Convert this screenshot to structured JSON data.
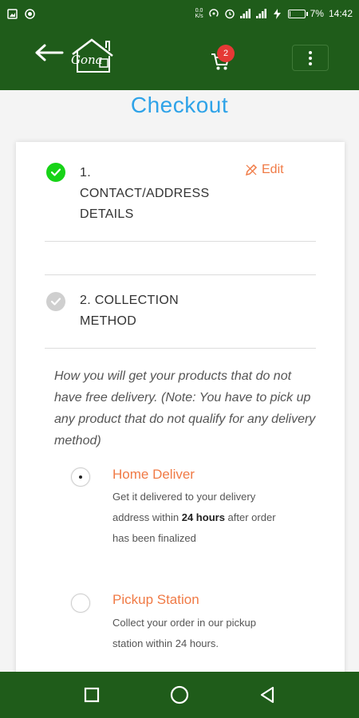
{
  "status_bar": {
    "net_speed_top": "0.0",
    "net_speed_bottom": "K/s",
    "battery_percent_text": "7%",
    "battery_level": 0.07,
    "time": "14:42"
  },
  "app_bar": {
    "logo_text": "Gona",
    "cart_count": "2",
    "menu_icon": "more-vertical-icon"
  },
  "page": {
    "title": "Checkout"
  },
  "steps": {
    "step1": {
      "label_line1": "1.",
      "label_line2": "CONTACT/ADDRESS",
      "label_line3": "DETAILS",
      "edit_label": "Edit"
    },
    "step2": {
      "label_line1": "2. COLLECTION",
      "label_line2": "METHOD"
    }
  },
  "collection": {
    "note": "How you will get your products that do not have free delivery. (Note: You have to pick up any product that do not qualify for any delivery method)",
    "options": [
      {
        "title": "Home Deliver",
        "desc_before": "Get it delivered to your delivery address within",
        "desc_bold": "24 hours",
        "desc_after": "after order has been finalized",
        "selected": true
      },
      {
        "title": "Pickup Station",
        "desc": "Collect your order in our pickup station within 24 hours.",
        "selected": false
      }
    ]
  },
  "colors": {
    "brand_green": "#1f5c1a",
    "title_blue": "#2fa3e8",
    "accent_orange": "#f07a45",
    "done_green": "#17d317",
    "badge_red": "#e53935"
  }
}
